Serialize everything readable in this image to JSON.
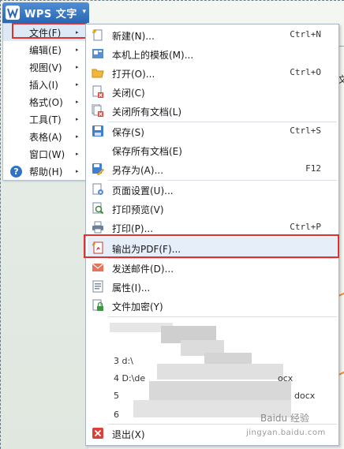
{
  "app": {
    "title": "WPS 文字",
    "arrow_glyph": "▾"
  },
  "left_menu": {
    "items": [
      {
        "label": "文件(F)",
        "arrow": "▸"
      },
      {
        "label": "编辑(E)",
        "arrow": "▸"
      },
      {
        "label": "视图(V)",
        "arrow": "▸"
      },
      {
        "label": "插入(I)",
        "arrow": "▸"
      },
      {
        "label": "格式(O)",
        "arrow": "▸"
      },
      {
        "label": "工具(T)",
        "arrow": "▸"
      },
      {
        "label": "表格(A)",
        "arrow": "▸"
      },
      {
        "label": "窗口(W)",
        "arrow": "▸"
      },
      {
        "label": "帮助(H)",
        "arrow": "▸"
      }
    ],
    "help_icon_glyph": "?"
  },
  "file_menu": {
    "items": [
      {
        "label": "新建(N)...",
        "shortcut": "Ctrl+N",
        "icon": "new-document-icon"
      },
      {
        "label": "本机上的模板(M)...",
        "shortcut": "",
        "icon": "template-icon"
      },
      {
        "label": "打开(O)...",
        "shortcut": "Ctrl+O",
        "icon": "open-folder-icon"
      },
      {
        "label": "关闭(C)",
        "shortcut": "",
        "icon": "close-document-icon"
      },
      {
        "label": "关闭所有文档(L)",
        "shortcut": "",
        "icon": "close-all-icon"
      },
      {
        "label": "保存(S)",
        "shortcut": "Ctrl+S",
        "icon": "save-icon"
      },
      {
        "label": "保存所有文档(E)",
        "shortcut": "",
        "icon": ""
      },
      {
        "label": "另存为(A)...",
        "shortcut": "F12",
        "icon": "save-as-icon"
      },
      {
        "label": "页面设置(U)...",
        "shortcut": "",
        "icon": "page-setup-icon"
      },
      {
        "label": "打印预览(V)",
        "shortcut": "",
        "icon": "print-preview-icon"
      },
      {
        "label": "打印(P)...",
        "shortcut": "Ctrl+P",
        "icon": "print-icon"
      },
      {
        "label": "输出为PDF(F)...",
        "shortcut": "",
        "icon": "pdf-export-icon"
      },
      {
        "label": "发送邮件(D)...",
        "shortcut": "",
        "icon": "mail-icon"
      },
      {
        "label": "属性(I)...",
        "shortcut": "",
        "icon": "properties-icon"
      },
      {
        "label": "文件加密(Y)",
        "shortcut": "",
        "icon": "encrypt-icon"
      },
      {
        "label": "退出(X)",
        "shortcut": "",
        "icon": "exit-icon"
      }
    ],
    "recent_files": [
      {
        "label": "3 d:\\"
      },
      {
        "label": "4 D:\\de"
      },
      {
        "label": "5"
      },
      {
        "label": "6"
      }
    ],
    "recent_suffix_1": "ocx",
    "recent_suffix_2": "docx"
  },
  "background": {
    "doc_char": "文"
  },
  "watermark": {
    "text": "Baidu 经验",
    "sub": "jingyan.baidu.com"
  },
  "colors": {
    "accent": "#2a66b4",
    "highlight_box": "#e03030",
    "hover_bg": "#e6eef9"
  }
}
